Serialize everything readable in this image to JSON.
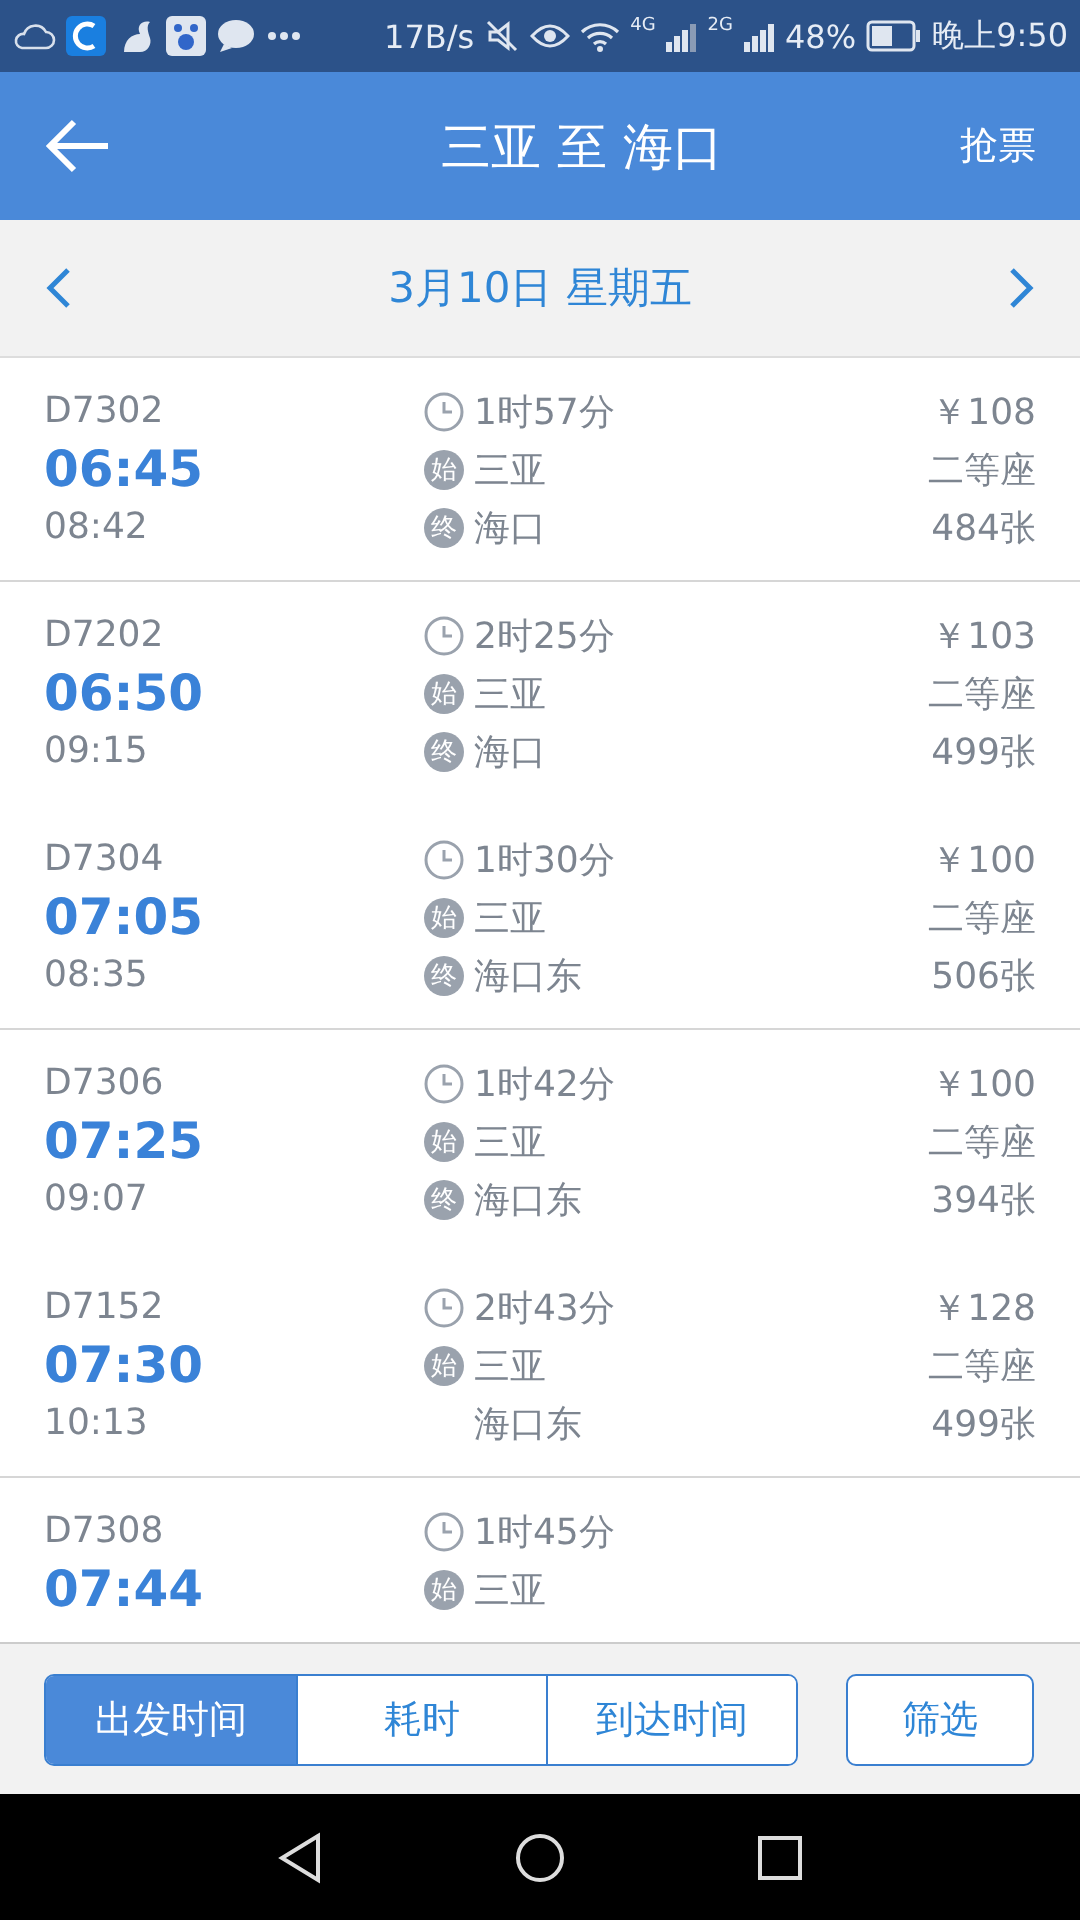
{
  "status_bar": {
    "speed": "17B/s",
    "network_4g": "4G",
    "network_2g": "2G",
    "battery": "48%",
    "time": "晚上9:50"
  },
  "header": {
    "title": "三亚 至 海口",
    "action": "抢票"
  },
  "date_bar": {
    "date": "3月10日 星期五"
  },
  "trains": [
    {
      "number": "D7302",
      "depart": "06:45",
      "arrive": "08:42",
      "duration": "1时57分",
      "from_badge": "始",
      "from": "三亚",
      "to_badge": "终",
      "to": "海口",
      "terminal": true,
      "price": "￥108",
      "seat": "二等座",
      "tickets": "484张",
      "divider": true
    },
    {
      "number": "D7202",
      "depart": "06:50",
      "arrive": "09:15",
      "duration": "2时25分",
      "from_badge": "始",
      "from": "三亚",
      "to_badge": "终",
      "to": "海口",
      "terminal": true,
      "price": "￥103",
      "seat": "二等座",
      "tickets": "499张",
      "divider": false
    },
    {
      "number": "D7304",
      "depart": "07:05",
      "arrive": "08:35",
      "duration": "1时30分",
      "from_badge": "始",
      "from": "三亚",
      "to_badge": "终",
      "to": "海口东",
      "terminal": true,
      "price": "￥100",
      "seat": "二等座",
      "tickets": "506张",
      "divider": true
    },
    {
      "number": "D7306",
      "depart": "07:25",
      "arrive": "09:07",
      "duration": "1时42分",
      "from_badge": "始",
      "from": "三亚",
      "to_badge": "终",
      "to": "海口东",
      "terminal": true,
      "price": "￥100",
      "seat": "二等座",
      "tickets": "394张",
      "divider": false
    },
    {
      "number": "D7152",
      "depart": "07:30",
      "arrive": "10:13",
      "duration": "2时43分",
      "from_badge": "始",
      "from": "三亚",
      "to": "海口东",
      "terminal": false,
      "price": "￥128",
      "seat": "二等座",
      "tickets": "499张",
      "divider": true
    },
    {
      "number": "D7308",
      "depart": "07:44",
      "duration": "1时45分",
      "from_badge": "始",
      "from": "三亚"
    }
  ],
  "sort_tabs": [
    {
      "label": "出发时间",
      "selected": true
    },
    {
      "label": "耗时",
      "selected": false
    },
    {
      "label": "到达时间",
      "selected": false
    }
  ],
  "filter_button": "筛选"
}
